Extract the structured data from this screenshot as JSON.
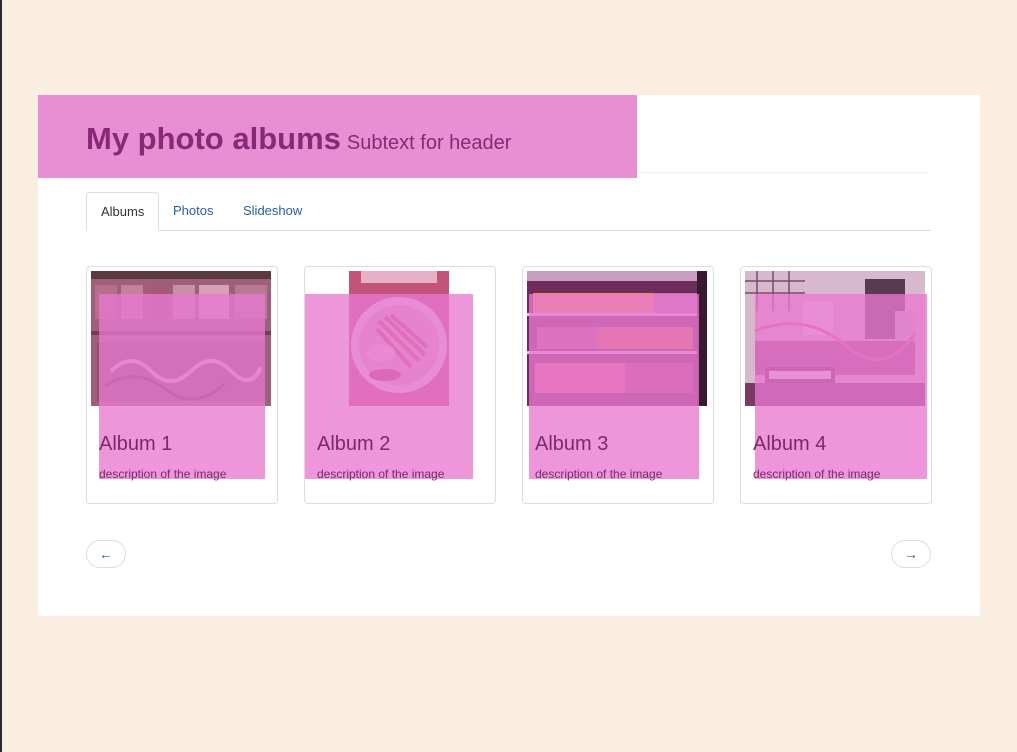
{
  "header": {
    "title": "My photo albums",
    "subtitle": "Subtext for header"
  },
  "tabs": [
    {
      "label": "Albums",
      "active": true
    },
    {
      "label": "Photos",
      "active": false
    },
    {
      "label": "Slideshow",
      "active": false
    }
  ],
  "albums": [
    {
      "title": "Album 1",
      "description": "description of the image",
      "image": "graffiti-storefront"
    },
    {
      "title": "Album 2",
      "description": "description of the image",
      "image": "plate-of-food"
    },
    {
      "title": "Album 3",
      "description": "description of the image",
      "image": "market-shelves"
    },
    {
      "title": "Album 4",
      "description": "description of the image",
      "image": "music-studio-gear"
    }
  ],
  "pager": {
    "prev_label": "←",
    "next_label": "→"
  },
  "colors": {
    "background": "#faeee0",
    "highlight": "#e88fd3",
    "link": "#2a5ea6"
  }
}
